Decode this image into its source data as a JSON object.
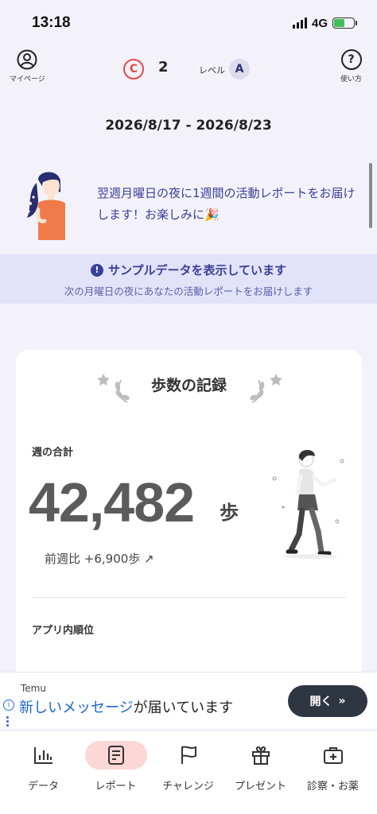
{
  "status_bar": {
    "time": "13:18",
    "network": "4G"
  },
  "header": {
    "mypage_label": "マイページ",
    "coin_symbol": "C",
    "coin_count": "2",
    "level_label": "レベル",
    "level_value": "A",
    "help_symbol": "?",
    "help_label": "使い方"
  },
  "date_range": "2026/8/17 - 2026/8/23",
  "notice": {
    "text": "翌週月曜日の夜に1週間の活動レポートをお届けします！お楽しみに🎉"
  },
  "sample_banner": {
    "icon": "!",
    "title": "サンプルデータを表示しています",
    "subtitle": "次の月曜日の夜にあなたの活動レポートをお届けします"
  },
  "steps_card": {
    "title": "歩数の記録",
    "week_total_label": "週の合計",
    "week_total_value": "42,482",
    "unit": "歩",
    "compare_text": "前週比  +6,900歩 ↗",
    "rank_label": "アプリ内順位"
  },
  "ad": {
    "brand": "Temu",
    "info_icon": "i",
    "highlight": "新しいメッセージ",
    "rest": "が届いています",
    "button_label": "開く",
    "button_icon": "»"
  },
  "tabs": [
    {
      "label": "データ",
      "icon": "bar-chart-icon",
      "active": false
    },
    {
      "label": "レポート",
      "icon": "report-icon",
      "active": true
    },
    {
      "label": "チャレンジ",
      "icon": "flag-icon",
      "active": false
    },
    {
      "label": "プレゼント",
      "icon": "gift-icon",
      "active": false
    },
    {
      "label": "診察・お薬",
      "icon": "medical-kit-icon",
      "active": false
    }
  ],
  "colors": {
    "accent": "#3a3f9a",
    "active_tab": "#fcd7d6",
    "coin": "#e24a4a"
  }
}
